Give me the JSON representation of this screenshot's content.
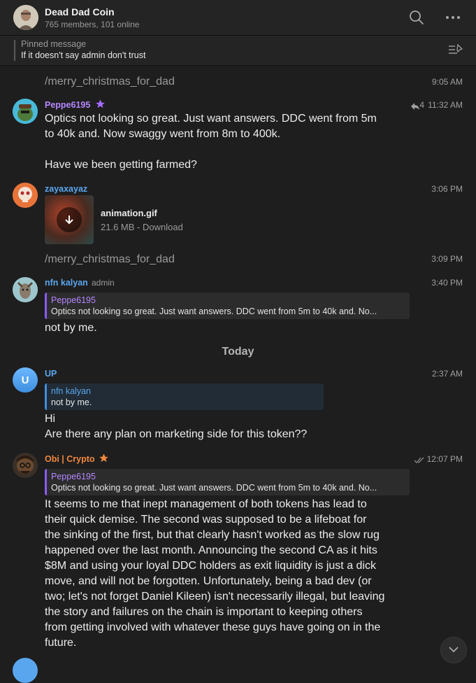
{
  "header": {
    "title": "Dead Dad Coin",
    "subtitle": "765 members, 101 online",
    "search_icon": "search-icon",
    "more_icon": "more-icon"
  },
  "pinned": {
    "title": "Pinned message",
    "text": "If it doesn't say admin don't trust"
  },
  "messages": {
    "m1": {
      "text": "/merry_christmas_for_dad",
      "time": "9:05 AM"
    },
    "m2": {
      "name": "Peppe6195",
      "forwards": "4",
      "time": "11:32 AM",
      "line1": "Optics not looking so great. Just want answers. DDC went from 5m",
      "line2": "to 40k and. Now swaggy went from 8m to 400k.",
      "line3": "Have we been getting farmed?"
    },
    "m3": {
      "name": "zayaxayaz",
      "time": "3:06 PM",
      "file_name": "animation.gif",
      "file_size": "21.6 MB",
      "file_action": "Download"
    },
    "m4": {
      "text": "/merry_christmas_for_dad",
      "time": "3:09 PM"
    },
    "m5": {
      "name": "nfn kalyan",
      "role": "admin",
      "time": "3:40 PM",
      "reply_name": "Peppe6195",
      "reply_text": "Optics not looking so great. Just want answers. DDC went from 5m to 40k and. No...",
      "text": "not by me."
    },
    "divider": "Today",
    "m6": {
      "avatar_letter": "U",
      "name": "UP",
      "time": "2:37 AM",
      "reply_name": "nfn kalyan",
      "reply_text": "not by me.",
      "line1": "Hi",
      "line2": "Are there any plan on marketing side for this token??"
    },
    "m7": {
      "name": "Obi | Crypto",
      "time": "12:07 PM",
      "reply_name": "Peppe6195",
      "reply_text": "Optics not looking so great. Just want answers. DDC went from 5m to 40k and. No...",
      "lines": [
        "It seems to me that inept management of both tokens has lead to",
        "their quick demise. The second was supposed to be a lifeboat for",
        "the sinking of the first, but that clearly hasn't worked as the slow rug",
        "happened over the last month. Announcing the second CA as it hits",
        "$8M and using your loyal DDC holders as exit liquidity is just a dick",
        "move, and will not be forgotten. Unfortunately, being a bad dev (or",
        "two; let's not forget Daniel Kileen) isn't necessarily illegal, but leaving",
        "the story and failures on the chain is important to keeping others",
        "from getting involved with whatever these guys have going on in the",
        "future."
      ]
    }
  },
  "colors": {
    "purple_name": "#b687ff",
    "blue_name": "#5aa6ee",
    "orange_name": "#f0883e",
    "background": "#1e1e1e"
  }
}
